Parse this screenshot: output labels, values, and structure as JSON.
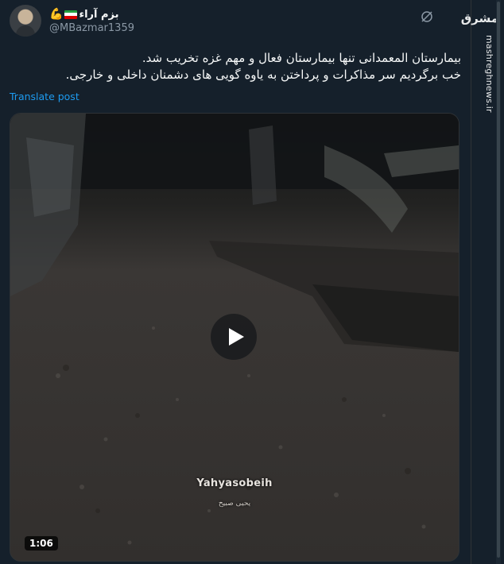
{
  "author": {
    "display_name": "بزم آراء",
    "handle": "@MBazmar1359",
    "flag_colors": [
      "#239f40",
      "#ffffff",
      "#da0000"
    ],
    "emoji_icon": "flexed-biceps-icon"
  },
  "tweet": {
    "text_line_1": "بیمارستان المعمدانی تنها بیمارستان فعال و مهم غزه تخریب شد.",
    "text_line_2": "خب برگردیم سر مذاکرات و پرداختن به یاوه گویی های دشمنان داخلی و خارجی.",
    "translate_label": "Translate post"
  },
  "media": {
    "type": "video",
    "watermark": "Yahyasobeih",
    "watermark_sub": "يحيى صبيح",
    "duration": "1:06",
    "play_icon": "play-icon"
  },
  "brand": {
    "logo_text": "مشرق",
    "url": "mashreghnews.ir"
  },
  "colors": {
    "background": "#15202b",
    "text": "#f7f9f9",
    "secondary_text": "#8b98a5",
    "link": "#1d9bf0"
  }
}
